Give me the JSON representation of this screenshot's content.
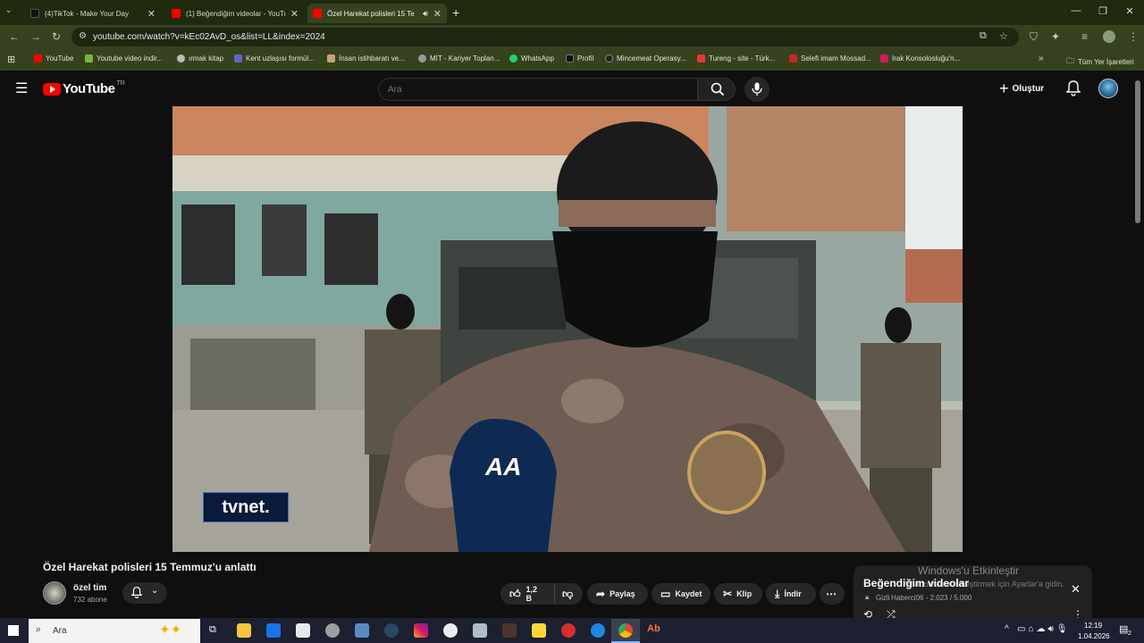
{
  "browser": {
    "tabs": [
      {
        "label": "(4)TikTok - Make Your Day",
        "active": false
      },
      {
        "label": "(1) Beğendiğim videolar - YouTube",
        "active": false
      },
      {
        "label": "Özel Harekat polisleri 15 Te",
        "active": true
      }
    ],
    "new_tab": "+",
    "url": "youtube.com/watch?v=kEc02AvD_os&list=LL&index=2024",
    "bookmarks": [
      "YouTube",
      "Youtube video indir...",
      "ırmak kitap",
      "Kent uzlaşısı formül...",
      "İnsan istihbaratı ve...",
      "MİT - Kariyer Toplan...",
      "WhatsApp",
      "Profil",
      "Mincemeat Operasy...",
      "Tureng - site - Türk...",
      "Selefi imam Mossad...",
      "Irak Konsolosluğu'n..."
    ],
    "all_bookmarks": "Tüm Yer İşaretleri"
  },
  "youtube": {
    "logo_text": "YouTube",
    "region": "TR",
    "search_placeholder": "Ara",
    "create_label": "Oluştur"
  },
  "video": {
    "watermark": "tvnet.",
    "mic_logo": "AA",
    "title": "Özel Harekat polisleri 15 Temmuz'u anlattı",
    "channel": "özel tim",
    "subscribers": "732 abone",
    "likes": "1,2 B",
    "share": "Paylaş",
    "save": "Kaydet",
    "clip": "Klip",
    "download": "İndir"
  },
  "playlist": {
    "title": "Beğendiğim videolar",
    "privacy": "Gizli",
    "owner_progress": "Haberci06 - 2.023 / 5.000"
  },
  "activation": {
    "title": "Windows'u Etkinleştir",
    "subtitle": "Windows'u etkinleştirmek için Ayarlar'a gidin."
  },
  "taskbar": {
    "search_placeholder": "Ara",
    "time": "12:19",
    "date": "1.04.2026",
    "notification_count": "2"
  },
  "colors": {
    "chrome_dark": "#1f2a0f",
    "chrome_mid": "#36421f",
    "youtube_red": "#ff0000",
    "yt_bg": "#0f0f0f",
    "pill_bg": "#272727"
  }
}
